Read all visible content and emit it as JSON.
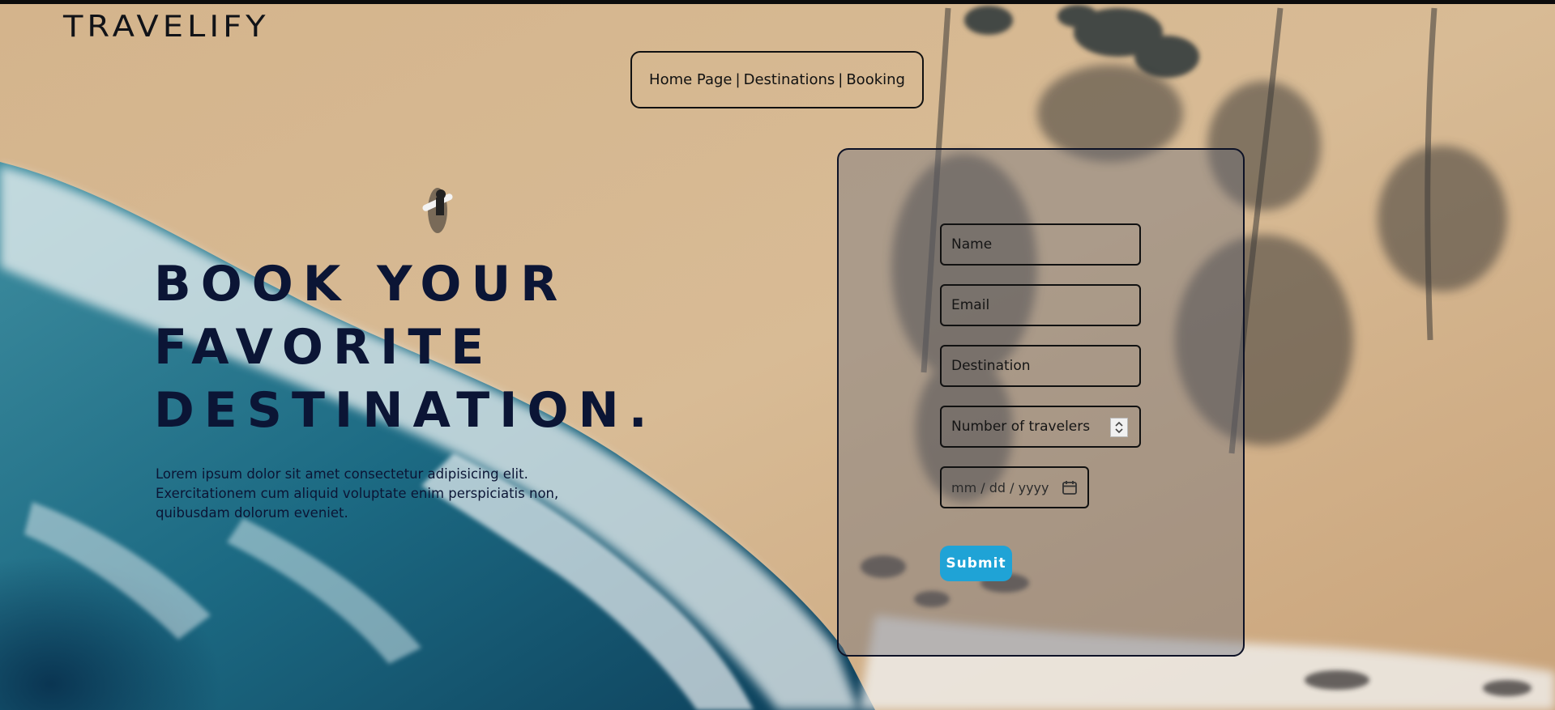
{
  "brand": {
    "logo_text": "TRAVELIFY"
  },
  "nav": {
    "items": [
      {
        "label": "Home Page"
      },
      {
        "label": "Destinations"
      },
      {
        "label": "Booking"
      }
    ],
    "separator": "|"
  },
  "hero": {
    "title_lines": [
      "BOOK YOUR",
      "FAVORITE",
      "DESTINATION."
    ],
    "description": "Lorem ipsum dolor sit amet consectetur adipisicing elit. Exercitationem cum aliquid voluptate enim perspiciatis non, quibusdam dolorum eveniet."
  },
  "form": {
    "name_placeholder": "Name",
    "email_placeholder": "Email",
    "destination_placeholder": "Destination",
    "travelers_placeholder": "Number of travelers",
    "date_placeholder": "mm / dd / yyyy",
    "submit_label": "Submit",
    "travelers_spinner_icon": "spinner-arrows-icon",
    "date_icon": "calendar-icon"
  },
  "colors": {
    "title_color": "#0b1535",
    "submit_bg": "#1fa3d6",
    "form_border": "#0d1226"
  }
}
